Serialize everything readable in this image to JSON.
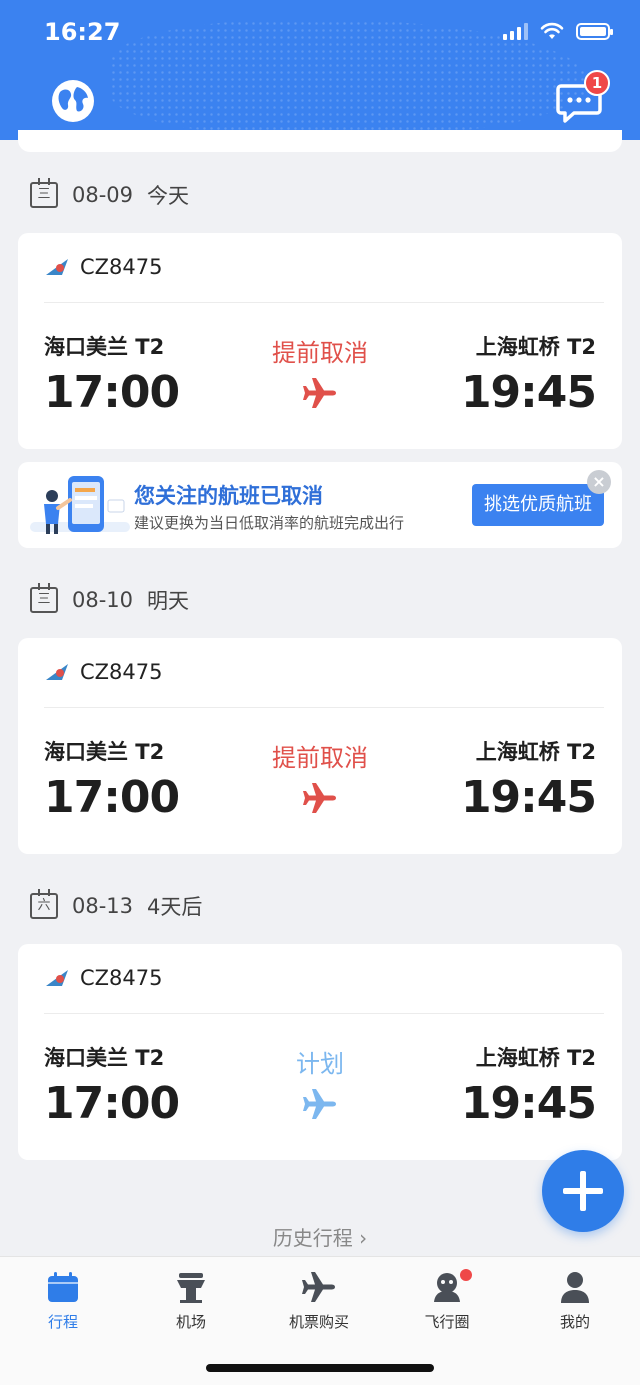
{
  "status_bar": {
    "time": "16:27"
  },
  "header": {
    "message_badge": "1",
    "colors": {
      "header_bg": "#3b82f0"
    }
  },
  "days": [
    {
      "weekday_icon": "三",
      "date": "08-09",
      "relative": "今天"
    },
    {
      "weekday_icon": "三",
      "date": "08-10",
      "relative": "明天"
    },
    {
      "weekday_icon": "六",
      "date": "08-13",
      "relative": "4天后"
    }
  ],
  "flights": [
    {
      "flight_no": "CZ8475",
      "dep_airport": "海口美兰 T2",
      "dep_time": "17:00",
      "status": "提前取消",
      "status_color": "#e0504a",
      "arr_airport": "上海虹桥 T2",
      "arr_time": "19:45"
    },
    {
      "flight_no": "CZ8475",
      "dep_airport": "海口美兰 T2",
      "dep_time": "17:00",
      "status": "提前取消",
      "status_color": "#e0504a",
      "arr_airport": "上海虹桥 T2",
      "arr_time": "19:45"
    },
    {
      "flight_no": "CZ8475",
      "dep_airport": "海口美兰 T2",
      "dep_time": "17:00",
      "status": "计划",
      "status_color": "#7cb7ef",
      "arr_airport": "上海虹桥 T2",
      "arr_time": "19:45"
    }
  ],
  "banner": {
    "title": "您关注的航班已取消",
    "subtitle": "建议更换为当日低取消率的航班完成出行",
    "button": "挑选优质航班"
  },
  "history_link": "历史行程 ›",
  "tabs": [
    {
      "label": "行程",
      "icon": "calendar-icon",
      "active": true
    },
    {
      "label": "机场",
      "icon": "airport-tower-icon"
    },
    {
      "label": "机票购买",
      "icon": "plane-icon"
    },
    {
      "label": "飞行圈",
      "icon": "community-icon"
    },
    {
      "label": "我的",
      "icon": "person-icon"
    }
  ]
}
